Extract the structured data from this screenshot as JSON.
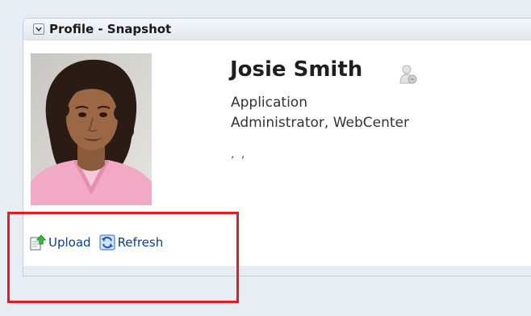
{
  "panel": {
    "title": "Profile - Snapshot",
    "disclose_icon": "chevron-down-icon"
  },
  "profile": {
    "name": "Josie Smith",
    "title": "Application\nAdministrator, WebCenter",
    "extra": ", ,",
    "presence_icon": "presence-status-icon",
    "photo": "profile-photo"
  },
  "actions": {
    "upload_label": "Upload",
    "upload_icon": "upload-icon",
    "refresh_label": "Refresh",
    "refresh_icon": "refresh-icon"
  },
  "annotation": {
    "highlight_color": "#e51c1c"
  }
}
